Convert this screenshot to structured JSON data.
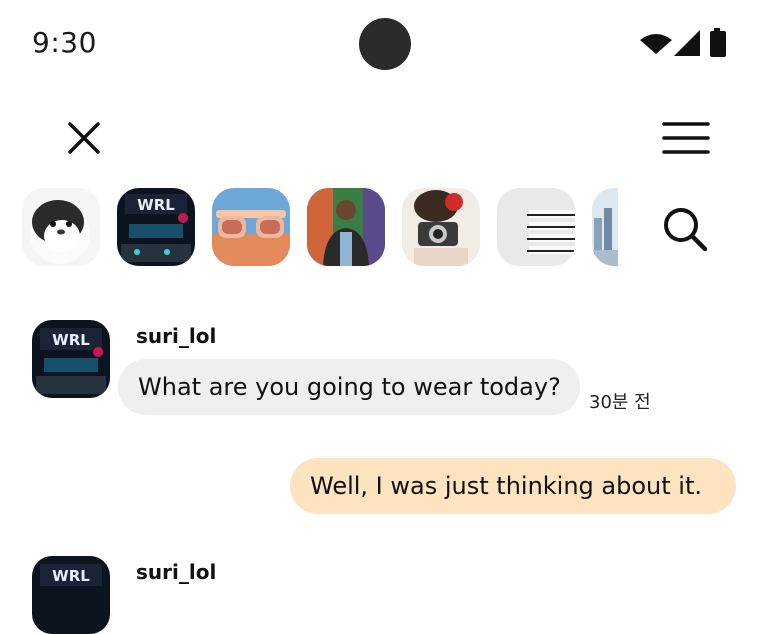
{
  "status_bar": {
    "time": "9:30",
    "icons": [
      "wifi-icon",
      "cell-signal-icon",
      "battery-icon"
    ]
  },
  "header": {
    "close_icon": "close-icon",
    "menu_icon": "hamburger-menu-icon",
    "search_icon": "search-icon"
  },
  "stories": [
    {
      "name": "story-penguin",
      "image": "penguin plush"
    },
    {
      "name": "story-worlds",
      "image": "Worlds esports stage"
    },
    {
      "name": "story-sunglasses",
      "image": "pink sunglasses"
    },
    {
      "name": "story-man-jacket",
      "image": "man in leather jacket"
    },
    {
      "name": "story-camera",
      "image": "person with camera and rose"
    },
    {
      "name": "story-vogue",
      "image": "stack of Vogue magazines"
    },
    {
      "name": "story-city",
      "image": "city skyline"
    }
  ],
  "messages": [
    {
      "sender": "suri_lol",
      "text": "What are you going to wear today?",
      "time": "30분 전",
      "direction": "incoming"
    },
    {
      "text": "Well, I was just thinking about it.",
      "direction": "outgoing"
    },
    {
      "sender": "suri_lol",
      "direction": "incoming"
    }
  ],
  "colors": {
    "incoming_bubble": "#efefef",
    "outgoing_bubble": "#fde3c0",
    "camera_cutout": "#2b2b2b"
  }
}
